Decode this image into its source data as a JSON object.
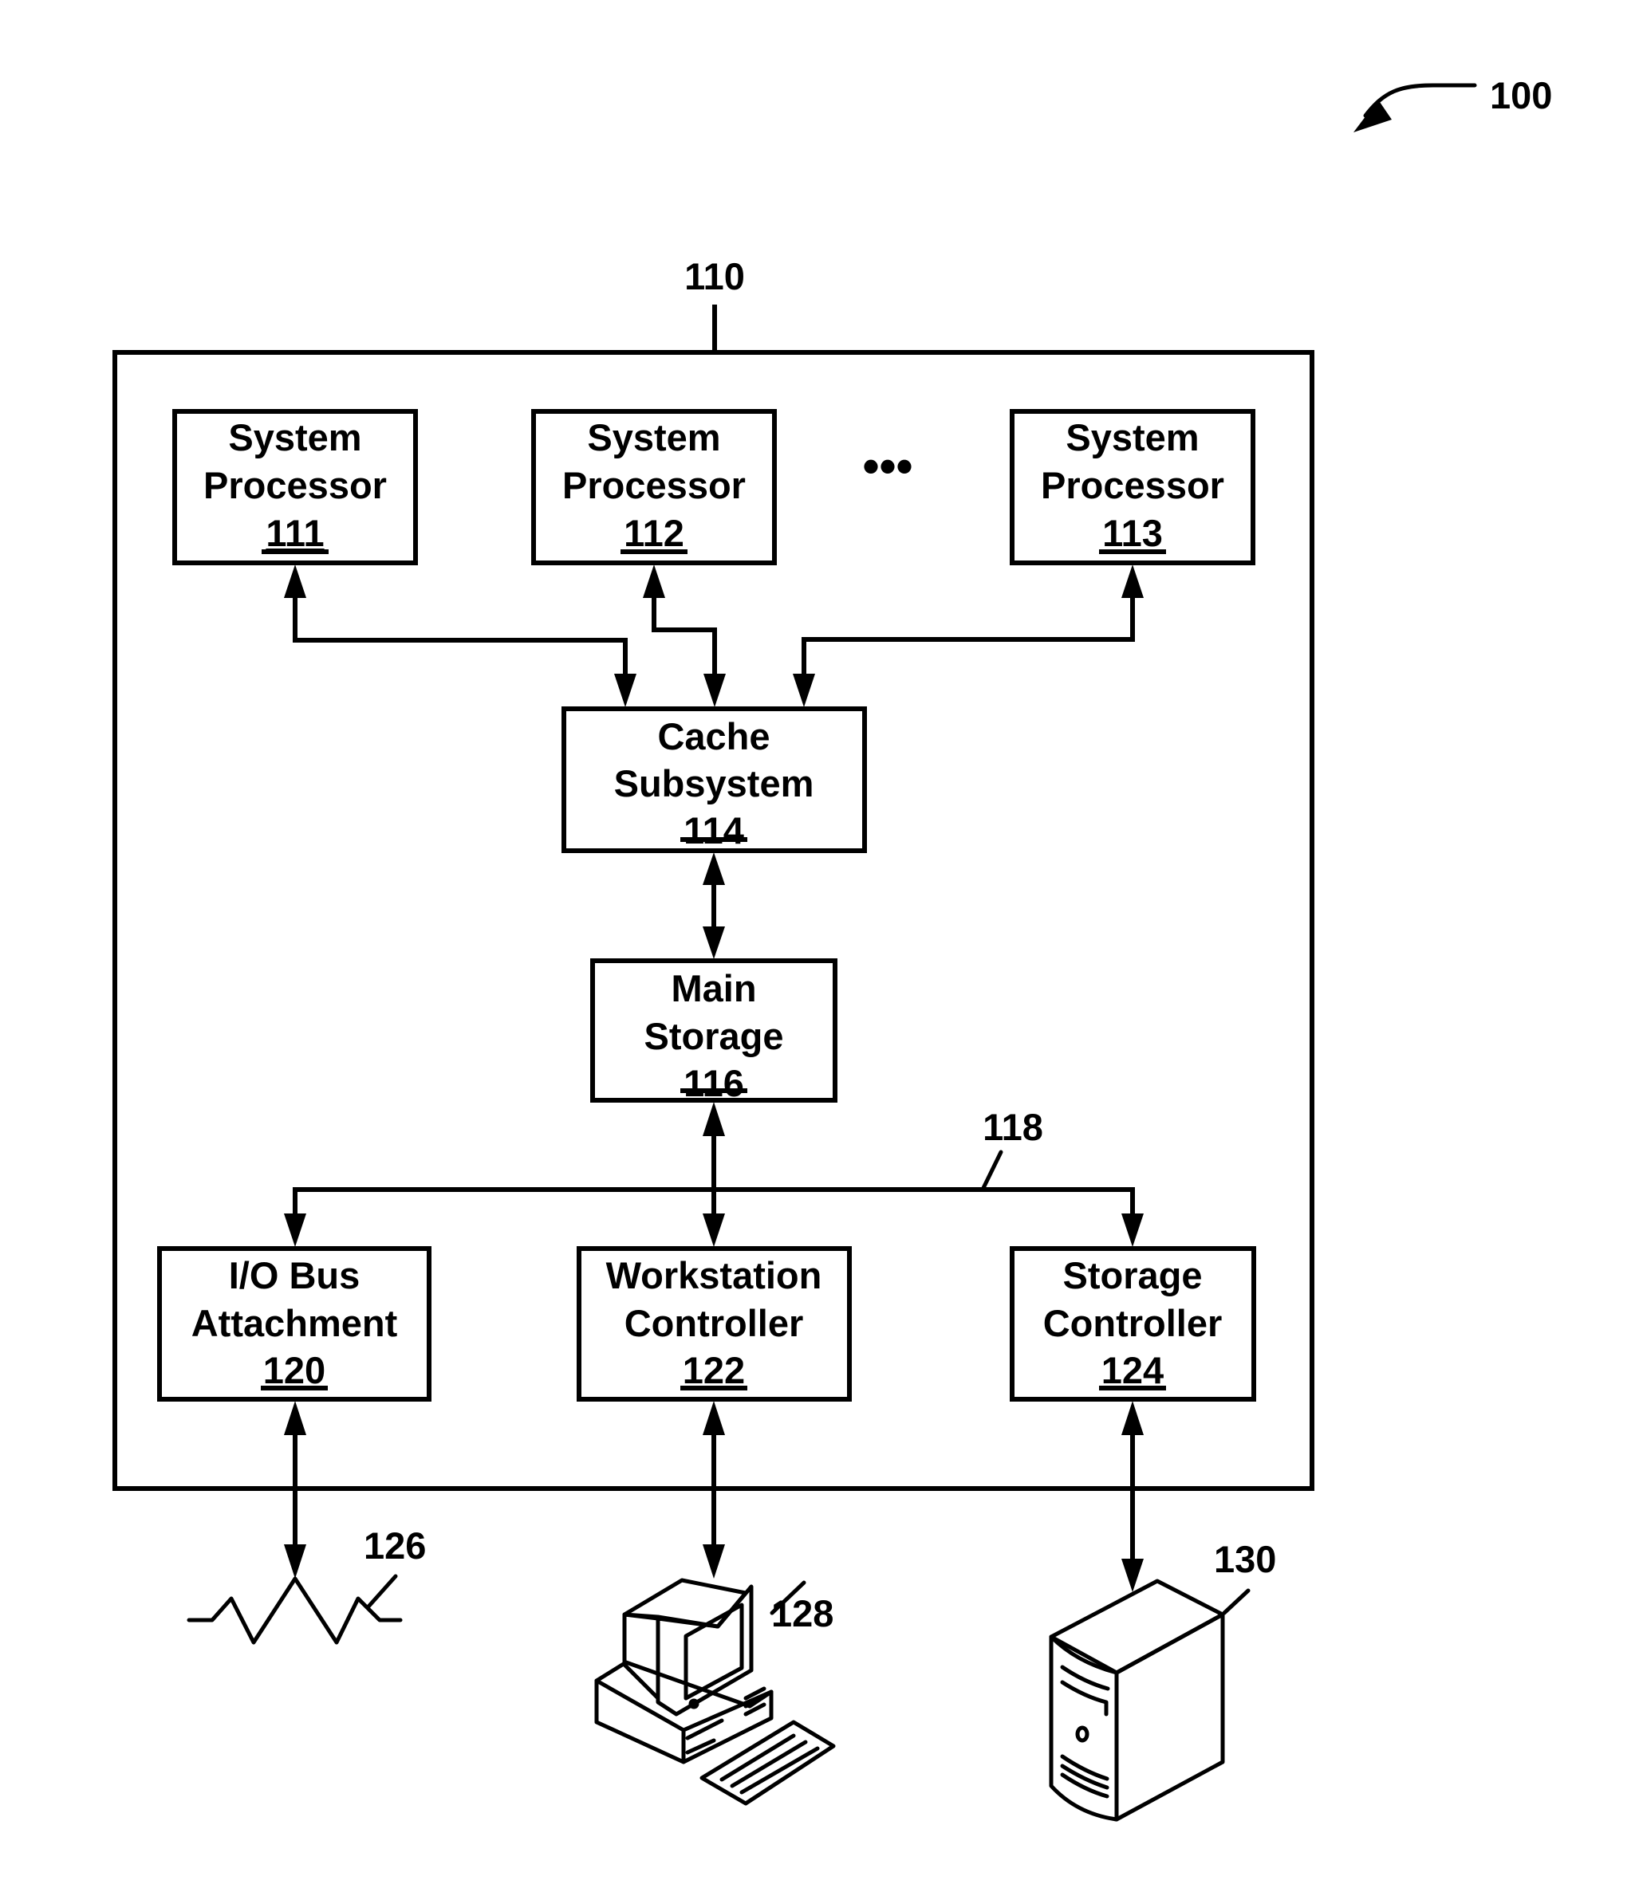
{
  "figure": {
    "figure_ref": "100",
    "system_ref": "110",
    "bus_ref": "118",
    "ellipsis": "•••",
    "processors": [
      {
        "line1": "System",
        "line2": "Processor",
        "ref": "111"
      },
      {
        "line1": "System",
        "line2": "Processor",
        "ref": "112"
      },
      {
        "line1": "System",
        "line2": "Processor",
        "ref": "113"
      }
    ],
    "cache": {
      "line1": "Cache",
      "line2": "Subsystem",
      "ref": "114"
    },
    "main_storage": {
      "line1": "Main",
      "line2": "Storage",
      "ref": "116"
    },
    "controllers": [
      {
        "line1": "I/O Bus",
        "line2": "Attachment",
        "ref": "120"
      },
      {
        "line1": "Workstation",
        "line2": "Controller",
        "ref": "122"
      },
      {
        "line1": "Storage",
        "line2": "Controller",
        "ref": "124"
      }
    ],
    "peripherals": {
      "network_ref": "126",
      "workstation_ref": "128",
      "storage_device_ref": "130"
    }
  }
}
